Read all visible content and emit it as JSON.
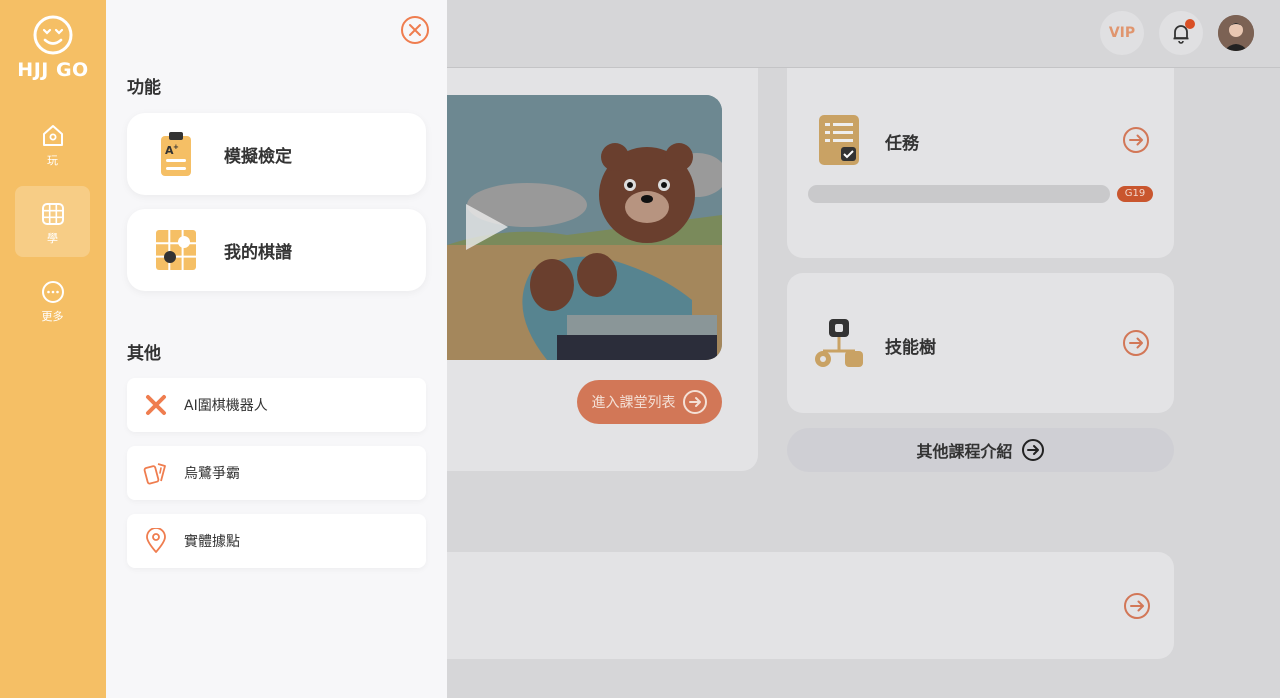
{
  "rail": {
    "brand": "HJJ GO",
    "items": [
      {
        "label": "玩",
        "icon": "home-icon"
      },
      {
        "label": "學",
        "icon": "grid-board-icon"
      },
      {
        "label": "更多",
        "icon": "more-dots-icon"
      }
    ],
    "active": "學"
  },
  "topbar": {
    "vip_label": "VIP",
    "notification_icon": "bell-icon",
    "has_notification": true
  },
  "background": {
    "enter_class_label": "進入課堂列表",
    "task_title": "任務",
    "task_badge": "G19",
    "skill_title": "技能樹",
    "other_courses_label": "其他課程介紹"
  },
  "drawer": {
    "section_features": "功能",
    "features": [
      {
        "label": "模擬檢定",
        "icon": "clipboard-grade-icon"
      },
      {
        "label": "我的棋譜",
        "icon": "go-board-icon"
      }
    ],
    "section_other": "其他",
    "others": [
      {
        "label": "AI圍棋機器人",
        "icon": "ai-cross-icon"
      },
      {
        "label": "烏鷺爭霸",
        "icon": "cards-icon"
      },
      {
        "label": "實體據點",
        "icon": "location-pin-icon"
      }
    ]
  },
  "colors": {
    "rail": "#f5bf65",
    "accent": "#ef7d4f",
    "drawer_bg": "#f7f7f9"
  }
}
